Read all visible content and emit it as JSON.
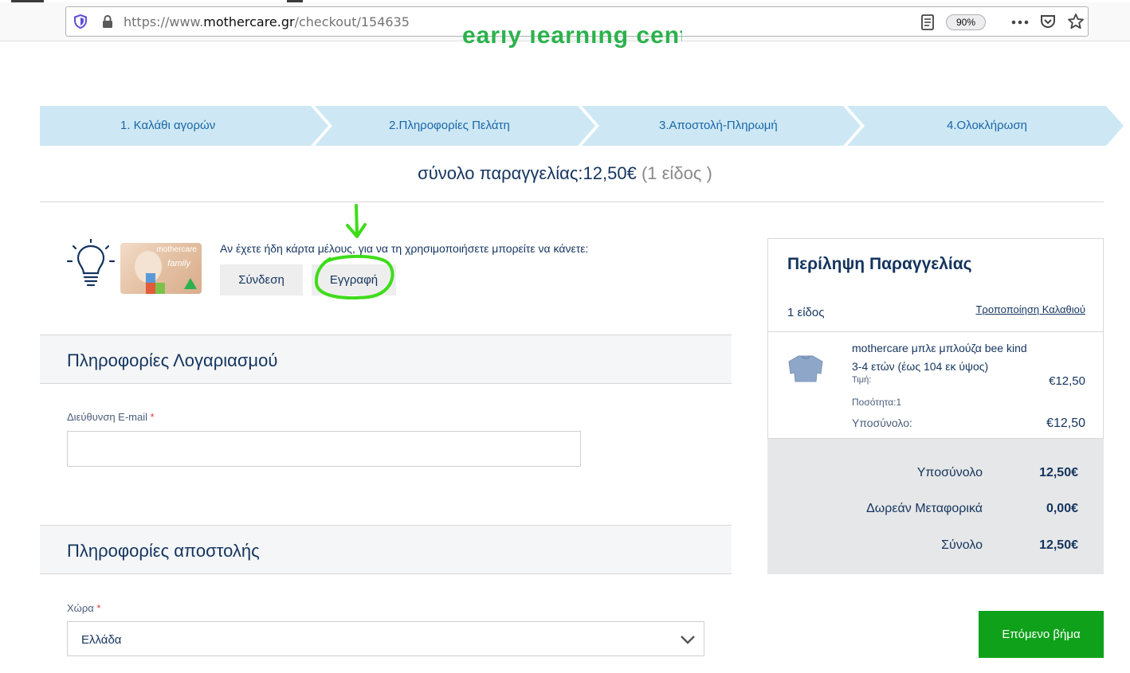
{
  "browser": {
    "url_prefix": "https://www.",
    "url_host": "mothercare.gr",
    "url_path": "/checkout/154635",
    "zoom": "90%"
  },
  "header": {
    "logo_text": "early learning centre"
  },
  "steps": [
    {
      "label": "1. Καλάθι αγορών"
    },
    {
      "label": "2.Πληροφορίες Πελάτη"
    },
    {
      "label": "3.Αποστολή-Πληρωμή"
    },
    {
      "label": "4.Ολοκλήρωση"
    }
  ],
  "order_total": {
    "label": "σύνολο παραγγελίας:12,50€",
    "count": "(1 είδος )"
  },
  "member": {
    "card_brand": "mothercare",
    "card_family": "family",
    "prompt": "Αν έχετε ήδη κάρτα μέλους, για να τη χρησιμοποιήσετε μπορείτε να κάνετε:",
    "login_label": "Σύνδεση",
    "register_label": "Εγγραφή"
  },
  "account": {
    "title": "Πληροφορίες Λογαριασμού",
    "email_label": "Διεύθυνση E-mail",
    "required_mark": "*",
    "email_value": ""
  },
  "shipping": {
    "title": "Πληροφορίες αποστολής",
    "country_label": "Χώρα",
    "country_value": "Ελλάδα"
  },
  "summary": {
    "title": "Περίληψη Παραγγελίας",
    "count": "1 είδος",
    "edit_cart": "Τροποποίηση Καλαθιού",
    "item": {
      "name": "mothercare μπλε μπλούζα bee kind",
      "size": "3-4 ετών (έως 104 εκ ύψος)",
      "price_label": "Τιμή:",
      "price": "€12,50",
      "qty_label": "Ποσότητα:1",
      "subtotal_label": "Υποσύνολο:",
      "subtotal": "€12,50"
    },
    "totals": [
      {
        "label": "Υποσύνολο",
        "value": "12,50€"
      },
      {
        "label": "Δωρεάν Μεταφορικά",
        "value": "0,00€"
      },
      {
        "label": "Σύνολο",
        "value": "12,50€"
      }
    ]
  },
  "next_button": "Επόμενο βήμα",
  "colors": {
    "brand_navy": "#14345f",
    "step_bg": "#cde8f4",
    "step_text": "#1b66a8",
    "next_green": "#10a11b",
    "annotation_green": "#3fdc1a"
  }
}
